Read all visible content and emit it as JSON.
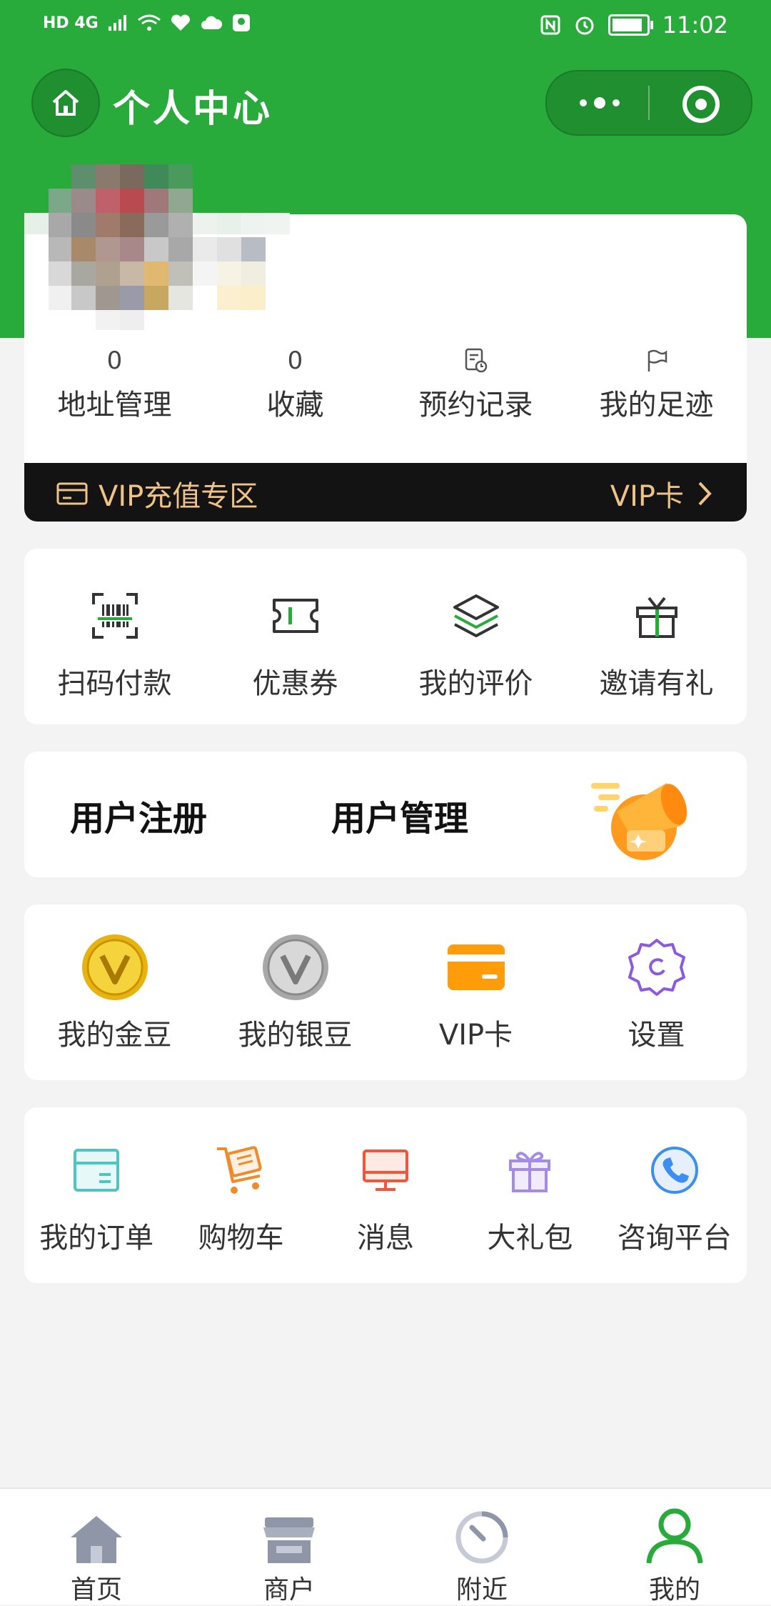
{
  "status_bar": {
    "left_text": "HD 4G",
    "time": "11:02"
  },
  "header": {
    "title": "个人中心"
  },
  "profile": {
    "stats": [
      {
        "value": "0",
        "label": "地址管理"
      },
      {
        "value": "0",
        "label": "收藏"
      },
      {
        "icon": "clipboard-clock-icon",
        "label": "预约记录"
      },
      {
        "icon": "flag-icon",
        "label": "我的足迹"
      }
    ],
    "vip_bar": {
      "left_label": "VIP充值专区",
      "right_label": "VIP卡"
    }
  },
  "quick_actions": [
    {
      "icon": "scan-barcode-icon",
      "label": "扫码付款"
    },
    {
      "icon": "coupon-icon",
      "label": "优惠券"
    },
    {
      "icon": "layers-icon",
      "label": "我的评价"
    },
    {
      "icon": "gift-box-icon",
      "label": "邀请有礼"
    }
  ],
  "user_mgmt": {
    "register_label": "用户注册",
    "manage_label": "用户管理"
  },
  "wallet": [
    {
      "icon": "gold-coin-icon",
      "label": "我的金豆"
    },
    {
      "icon": "silver-coin-icon",
      "label": "我的银豆"
    },
    {
      "icon": "vip-card-icon",
      "label": "VIP卡"
    },
    {
      "icon": "settings-gear-icon",
      "label": "设置"
    }
  ],
  "services": [
    {
      "icon": "order-box-icon",
      "label": "我的订单"
    },
    {
      "icon": "shopping-cart-icon",
      "label": "购物车"
    },
    {
      "icon": "monitor-icon",
      "label": "消息"
    },
    {
      "icon": "gift-icon",
      "label": "大礼包"
    },
    {
      "icon": "phone-icon",
      "label": "咨询平台"
    }
  ],
  "tabbar": [
    {
      "icon": "home-tab-icon",
      "label": "首页"
    },
    {
      "icon": "shop-tab-icon",
      "label": "商户"
    },
    {
      "icon": "clock-tab-icon",
      "label": "附近"
    },
    {
      "icon": "user-tab-icon",
      "label": "我的",
      "active": true
    }
  ],
  "colors": {
    "brand_green": "#29ab3b",
    "vip_gold": "#efc286",
    "vip_bar_bg": "#131313",
    "page_bg": "#f3f3f3"
  }
}
